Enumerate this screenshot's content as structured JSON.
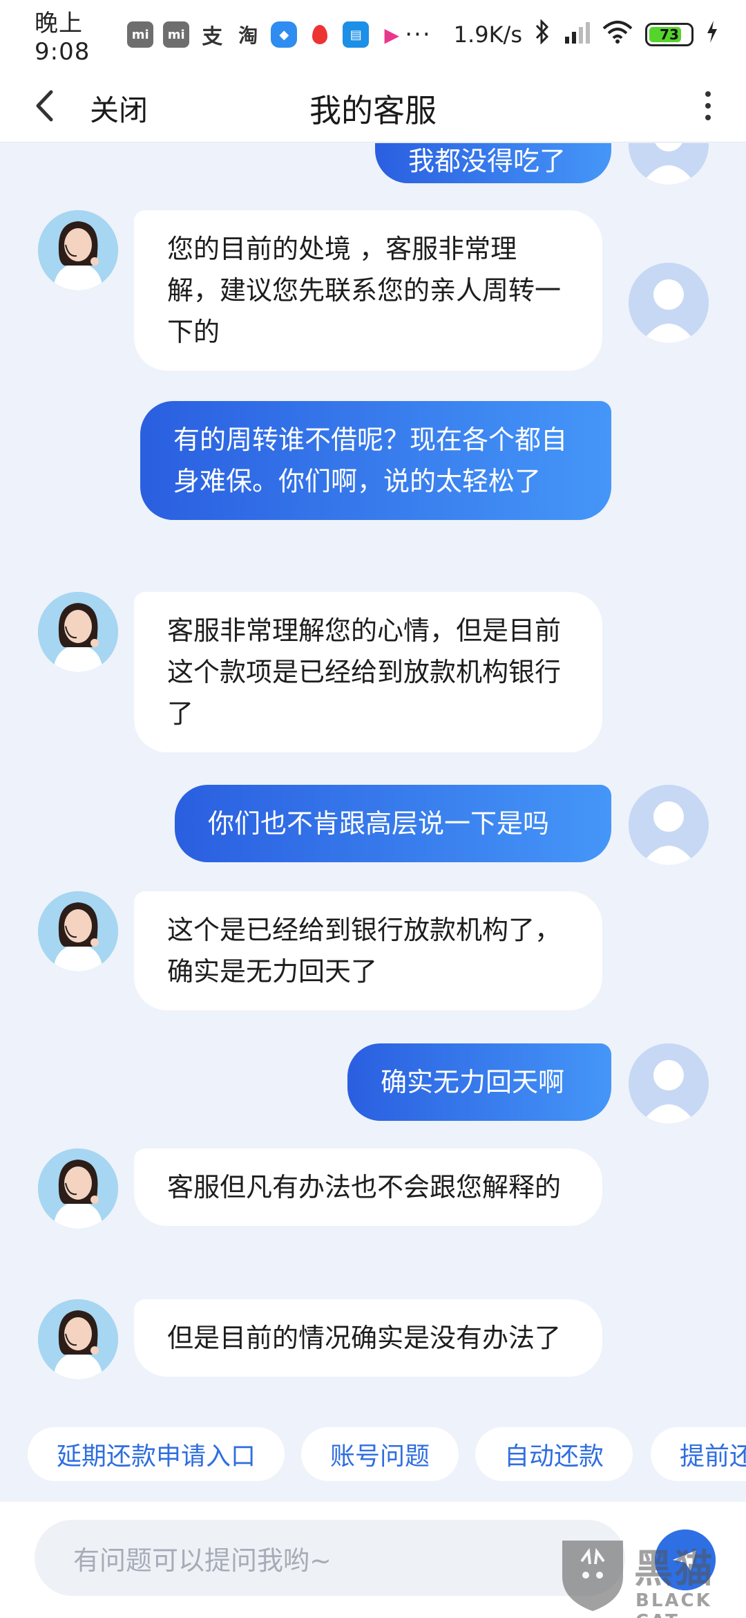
{
  "status_bar": {
    "time": "晚上9:08",
    "more": "···",
    "net_speed": "1.9K/s",
    "battery": "73",
    "app_icons": [
      "mi-icon",
      "mi-icon",
      "alipay-icon",
      "taobao-icon",
      "blue-app-icon",
      "map-pin-icon",
      "doc-app-icon",
      "video-play-icon"
    ]
  },
  "nav": {
    "close_label": "关闭",
    "title": "我的客服"
  },
  "messages": [
    {
      "from": "user",
      "text": "我都没得吃了"
    },
    {
      "from": "agent",
      "text": "您的目前的处境 ，客服非常理解，建议您先联系您的亲人周转一下的"
    },
    {
      "from": "user",
      "text": "有的周转谁不借呢？现在各个都自身难保。你们啊，说的太轻松了"
    },
    {
      "from": "agent",
      "text": "客服非常理解您的心情，但是目前这个款项是已经给到放款机构银行了"
    },
    {
      "from": "user",
      "text": "你们也不肯跟高层说一下是吗"
    },
    {
      "from": "agent",
      "text": "这个是已经给到银行放款机构了，确实是无力回天了"
    },
    {
      "from": "user",
      "text": "确实无力回天啊"
    },
    {
      "from": "agent",
      "text": "客服但凡有办法也不会跟您解释的"
    },
    {
      "from": "agent",
      "text": "但是目前的情况确实是没有办法了"
    }
  ],
  "quick_replies": [
    "延期还款申请入口",
    "账号问题",
    "自动还款",
    "提前还"
  ],
  "input": {
    "placeholder": "有问题可以提问我哟~"
  },
  "watermark": {
    "cn": "黑猫",
    "en": "BLACK CAT"
  },
  "colors": {
    "user_bubble_start": "#2a5fe0",
    "user_bubble_end": "#4596f8",
    "chip_text": "#2f6ee0",
    "background": "#eef2fa"
  }
}
